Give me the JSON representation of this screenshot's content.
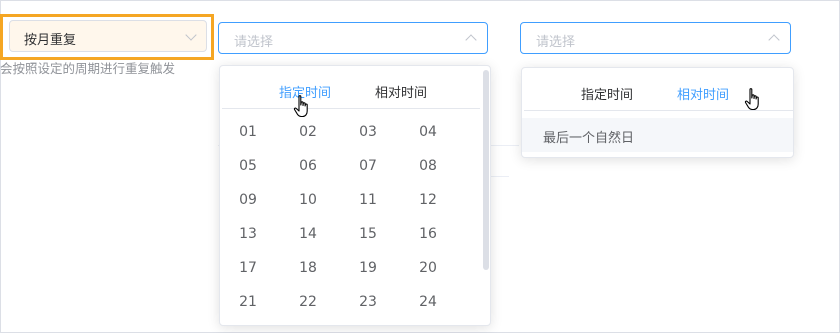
{
  "left_select": {
    "value": "按月重复"
  },
  "hint_text": "会按照设定的周期进行重复触发",
  "middle_select": {
    "placeholder": "请选择",
    "tabs": {
      "specified": "指定时间",
      "relative": "相对时间"
    },
    "active_tab": "specified",
    "days": [
      "01",
      "02",
      "03",
      "04",
      "05",
      "06",
      "07",
      "08",
      "09",
      "10",
      "11",
      "12",
      "13",
      "14",
      "15",
      "16",
      "17",
      "18",
      "19",
      "20",
      "21",
      "22",
      "23",
      "24"
    ]
  },
  "right_select": {
    "placeholder": "请选择",
    "tabs": {
      "specified": "指定时间",
      "relative": "相对时间"
    },
    "active_tab": "relative",
    "option": "最后一个自然日"
  },
  "colors": {
    "accent": "#409eff",
    "highlight": "#f5a623",
    "text": "#606266",
    "placeholder": "#c0c4cc"
  },
  "icons": {
    "chevron": "chevron-icon",
    "cursor": "hand-pointer-icon"
  }
}
